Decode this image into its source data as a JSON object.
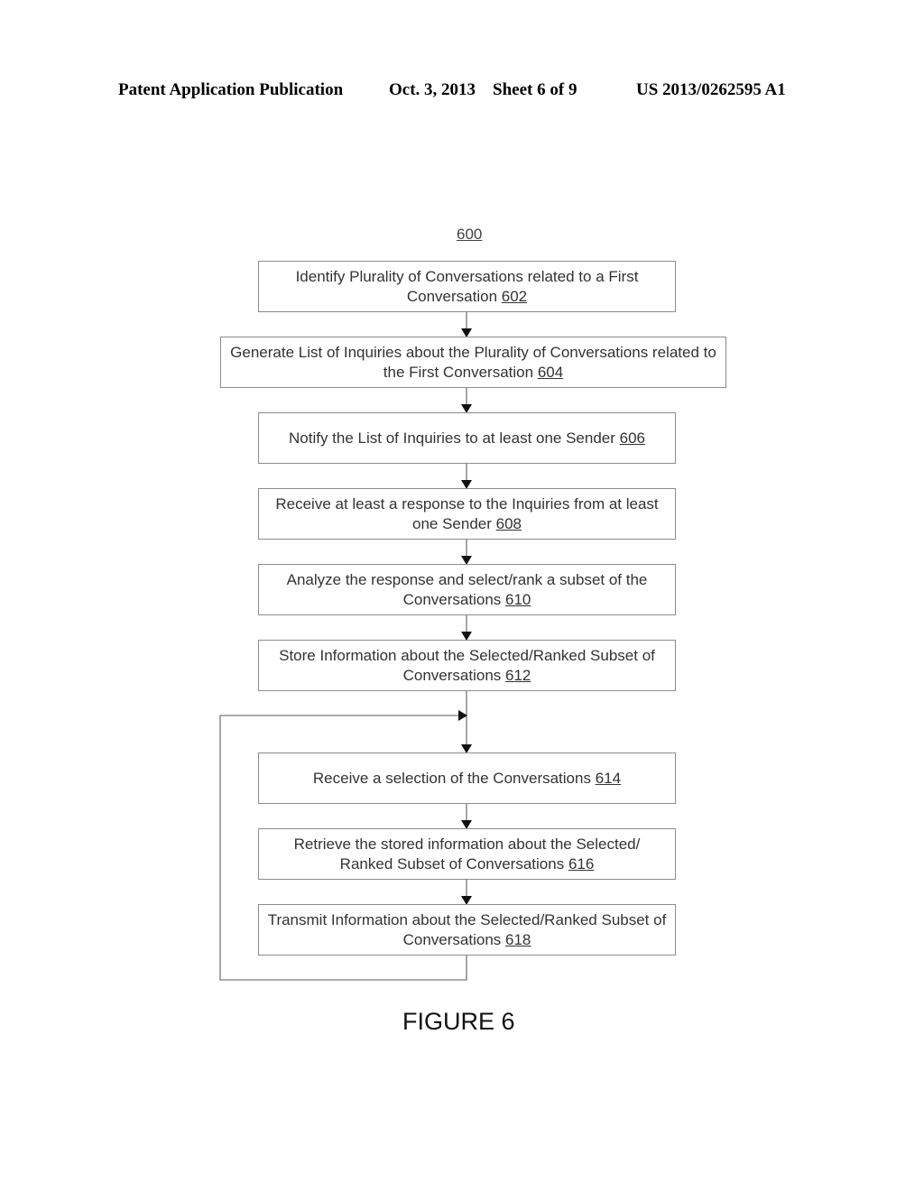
{
  "header": {
    "left": "Patent Application Publication",
    "middle": "Oct. 3, 2013    Sheet 6 of 9",
    "right": "US 2013/0262595 A1"
  },
  "figure_ref": "600",
  "steps": [
    {
      "text": "Identify Plurality of Conversations related to a First Conversation ",
      "ref": "602"
    },
    {
      "text": "Generate List of Inquiries about the Plurality of Conversations related to the First Conversation ",
      "ref": "604"
    },
    {
      "text": "Notify the List of Inquiries to at least one Sender ",
      "ref": "606"
    },
    {
      "text": "Receive at least a response to the Inquiries from at least one Sender ",
      "ref": "608"
    },
    {
      "text": "Analyze the response and select/rank a subset of the Conversations ",
      "ref": "610"
    },
    {
      "text": "Store Information about the Selected/Ranked Subset of Conversations ",
      "ref": "612"
    },
    {
      "text": "Receive a selection of the Conversations ",
      "ref": "614"
    },
    {
      "text": "Retrieve the stored information about the Selected/ Ranked Subset of Conversations ",
      "ref": "616"
    },
    {
      "text": "Transmit Information about the Selected/Ranked Subset of Conversations ",
      "ref": "618"
    }
  ],
  "caption": "FIGURE 6"
}
